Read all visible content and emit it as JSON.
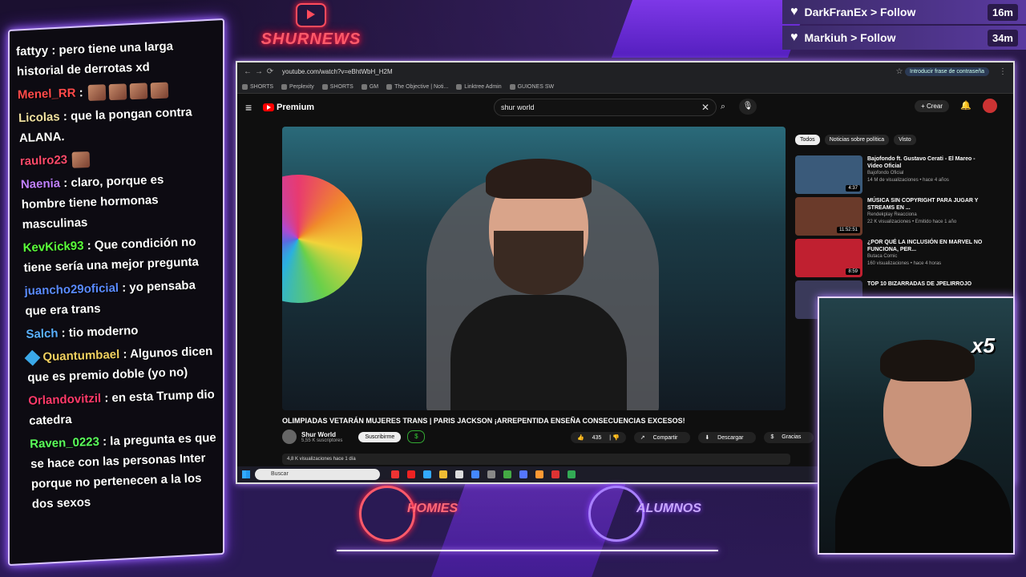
{
  "overlay": {
    "logo_text": "SHURNEWS",
    "brand_left": "HOMIES",
    "brand_right": "ALUMNOS",
    "webcam_badge": "x5"
  },
  "alerts": [
    {
      "user": "DarkFranEx",
      "action": "> Follow",
      "time": "16m"
    },
    {
      "user": "Markiuh",
      "action": "> Follow",
      "time": "34m"
    }
  ],
  "chat": [
    {
      "user": "fattyy",
      "color": "#ffffff",
      "text": "pero tiene una larga historial de derrotas xd"
    },
    {
      "user": "Menel_RR",
      "color": "#ff4a4a",
      "text": ""
    },
    {
      "user": "Licolas",
      "color": "#f0e0a0",
      "text": "que la pongan contra ALANA."
    },
    {
      "user": "raulro23",
      "color": "#ff4a6a",
      "text": ""
    },
    {
      "user": "Naenia",
      "color": "#c080ff",
      "text": "claro, porque es hombre tiene hormonas masculinas"
    },
    {
      "user": "KevKick93",
      "color": "#5aff3a",
      "text": "Que condición no tiene sería una mejor pregunta"
    },
    {
      "user": "juancho29oficial",
      "color": "#5a8aff",
      "text": "yo pensaba que era trans"
    },
    {
      "user": "Salch",
      "color": "#5ab0ff",
      "text": "tio moderno"
    },
    {
      "user": "Quantumbael",
      "color": "#f0d060",
      "text": "Algunos dicen que es premio doble (yo no)"
    },
    {
      "user": "Orlandovitzil",
      "color": "#ff3a6a",
      "text": "en esta Trump dio catedra"
    },
    {
      "user": "Raven_0223",
      "color": "#5aff5a",
      "text": "la pregunta es que se hace con las personas Inter porque no pertenecen a la los dos sexos"
    }
  ],
  "browser": {
    "url": "youtube.com/watch?v=eBhtWbH_H2M",
    "password_prompt": "Introducir frase de contraseña",
    "bookmarks": [
      "SHORTS",
      "Perplexity",
      "SHORTS",
      "GM",
      "The Objective | Noti...",
      "Linktree Admin",
      "GUIONES SW"
    ]
  },
  "youtube": {
    "logo": "Premium",
    "search_value": "shur world",
    "create_label": "Crear",
    "video_title": "OLIMPIADAS VETARÁN MUJERES TRANS | PARIS JACKSON ¡ARREPENTIDA ENSEÑA CONSECUENCIAS EXCESOS!",
    "channel_name": "Shur World",
    "channel_subs": "5,55 K suscriptores",
    "subscribe_label": "Suscribirme",
    "likes": "435",
    "share_label": "Compartir",
    "download_label": "Descargar",
    "thanks_label": "Gracias",
    "views": "4,8 K visualizaciones  hace 1 día",
    "side_tabs": [
      "Todos",
      "Noticias sobre política",
      "Visto"
    ],
    "recommended": [
      {
        "title": "Bajofondo ft. Gustavo Cerati - El Mareo - Video Oficial",
        "channel": "Bajofondo Oficial",
        "meta": "14 M de visualizaciones • hace 4 años",
        "duration": "4:37",
        "color": "#3a5a7a"
      },
      {
        "title": "MÚSICA SIN COPYRIGHT PARA JUGAR Y STREAMS EN ...",
        "channel": "Rendekplay Reacciona",
        "meta": "22 K visualizaciones • Emitido hace 1 año",
        "duration": "11:52:51",
        "color": "#6a3a2a"
      },
      {
        "title": "¿POR QUÉ LA INCLUSIÓN EN MARVEL NO FUNCIONA, PER...",
        "channel": "Butaca Comic",
        "meta": "160 visualizaciones • hace 4 horas",
        "duration": "8:59",
        "color": "#c02030"
      },
      {
        "title": "TOP 10 BIZARRADAS DE JPELIRROJO",
        "channel": "",
        "meta": "",
        "duration": "",
        "color": "#3a3a5a"
      }
    ]
  },
  "taskbar": {
    "search_placeholder": "Buscar"
  }
}
